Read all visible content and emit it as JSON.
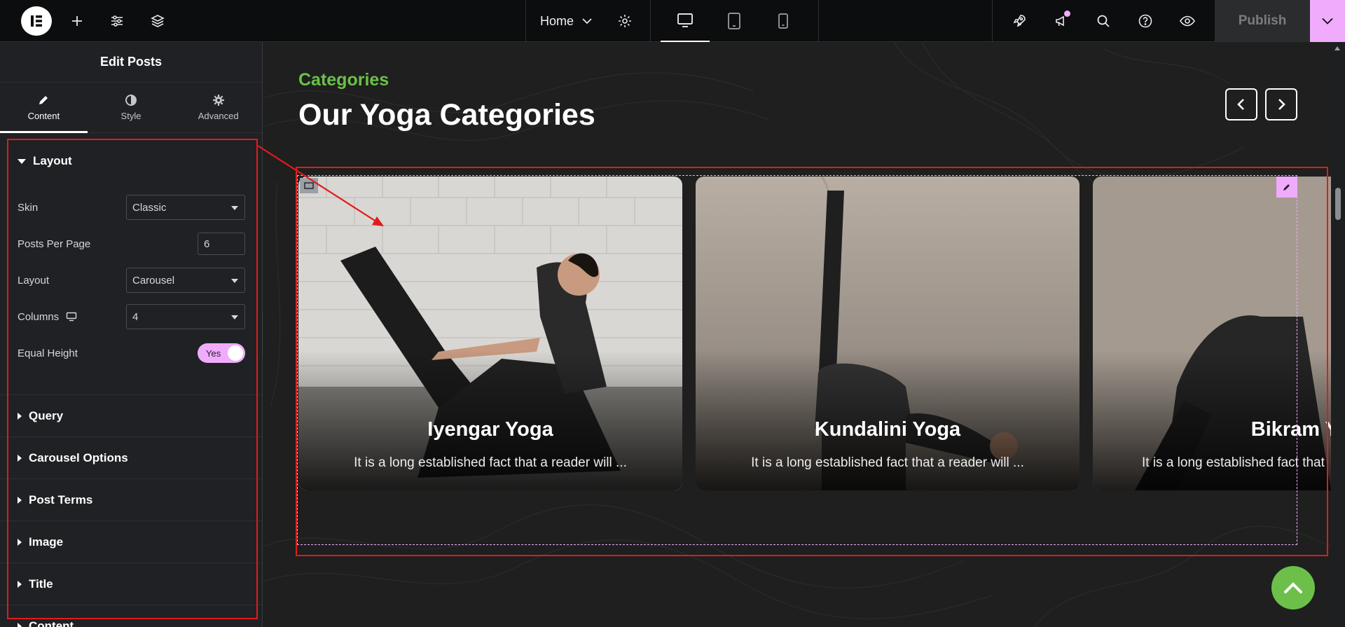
{
  "topbar": {
    "page_name": "Home",
    "publish_label": "Publish",
    "icons": [
      "elementor-logo-icon",
      "plus-icon",
      "sliders-icon",
      "layers-icon",
      "gear-icon",
      "desktop-icon",
      "tablet-icon",
      "mobile-icon",
      "rocket-icon",
      "megaphone-icon",
      "search-icon",
      "help-icon",
      "eye-icon",
      "chevron-down-icon"
    ]
  },
  "panel": {
    "title": "Edit Posts",
    "tabs": [
      {
        "label": "Content",
        "icon": "pencil-icon",
        "active": true
      },
      {
        "label": "Style",
        "icon": "contrast-icon",
        "active": false
      },
      {
        "label": "Advanced",
        "icon": "gear-icon",
        "active": false
      }
    ],
    "layout_section": {
      "title": "Layout",
      "skin_label": "Skin",
      "skin_value": "Classic",
      "posts_per_page_label": "Posts Per Page",
      "posts_per_page_value": "6",
      "layout_label": "Layout",
      "layout_value": "Carousel",
      "columns_label": "Columns",
      "columns_value": "4",
      "equal_height_label": "Equal Height",
      "equal_height_value": "Yes"
    },
    "collapsed_sections": [
      "Query",
      "Carousel Options",
      "Post Terms",
      "Image",
      "Title",
      "Content"
    ]
  },
  "canvas": {
    "eyebrow": "Categories",
    "heading": "Our Yoga Categories",
    "cards": [
      {
        "title": "Iyengar Yoga",
        "excerpt": "It is a long established fact that a reader will ..."
      },
      {
        "title": "Kundalini Yoga",
        "excerpt": "It is a long established fact that a reader will ..."
      },
      {
        "title": "Bikram Yog",
        "excerpt": "It is a long established fact that"
      }
    ]
  },
  "colors": {
    "accent_pink": "#f0abfc",
    "accent_green": "#6cc04a",
    "annotation_red": "#e01b1b",
    "topbar_bg": "#0c0d0e",
    "panel_bg": "#1f2124"
  }
}
